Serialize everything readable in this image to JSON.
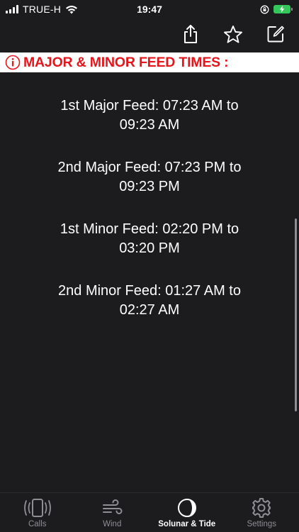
{
  "status_bar": {
    "carrier": "TRUE-H",
    "time": "19:47"
  },
  "toolbar": {
    "share_icon": "share-icon",
    "favorite_icon": "star-icon",
    "edit_icon": "compose-icon"
  },
  "banner": {
    "title": "MAJOR & MINOR FEED TIMES :",
    "icon": "info-icon",
    "color": "#e6151b"
  },
  "feeds": [
    {
      "text": "1st Major Feed: 07:23 AM to 09:23 AM"
    },
    {
      "text": "2nd Major Feed: 07:23 PM to 09:23 PM"
    },
    {
      "text": "1st Minor Feed: 02:20 PM to 03:20 PM"
    },
    {
      "text": "2nd Minor Feed: 01:27 AM to 02:27 AM"
    }
  ],
  "tabs": [
    {
      "label": "Calls",
      "icon": "phone-vibrate-icon",
      "active": false
    },
    {
      "label": "Wind",
      "icon": "wind-icon",
      "active": false
    },
    {
      "label": "Solunar & Tide",
      "icon": "moon-icon",
      "active": true
    },
    {
      "label": "Settings",
      "icon": "gear-icon",
      "active": false
    }
  ]
}
